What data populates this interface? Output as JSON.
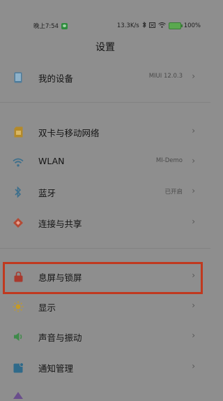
{
  "status_bar": {
    "time": "晚上7:54",
    "net_speed": "13.3K/s",
    "battery": "100"
  },
  "header": {
    "title": "设置"
  },
  "settings": {
    "device": {
      "label": "我的设备",
      "value": "MIUI 12.0.3"
    },
    "sim": {
      "label": "双卡与移动网络"
    },
    "wlan": {
      "label": "WLAN",
      "value": "MI-Demo"
    },
    "bluetooth": {
      "label": "蓝牙",
      "value": "已开启"
    },
    "share": {
      "label": "连接与共享"
    },
    "lock": {
      "label": "息屏与锁屏"
    },
    "display": {
      "label": "显示"
    },
    "sound": {
      "label": "声音与振动"
    },
    "notifications": {
      "label": "通知管理"
    }
  },
  "colors": {
    "highlight": "#c0391f",
    "background": "#8e8e8e"
  }
}
